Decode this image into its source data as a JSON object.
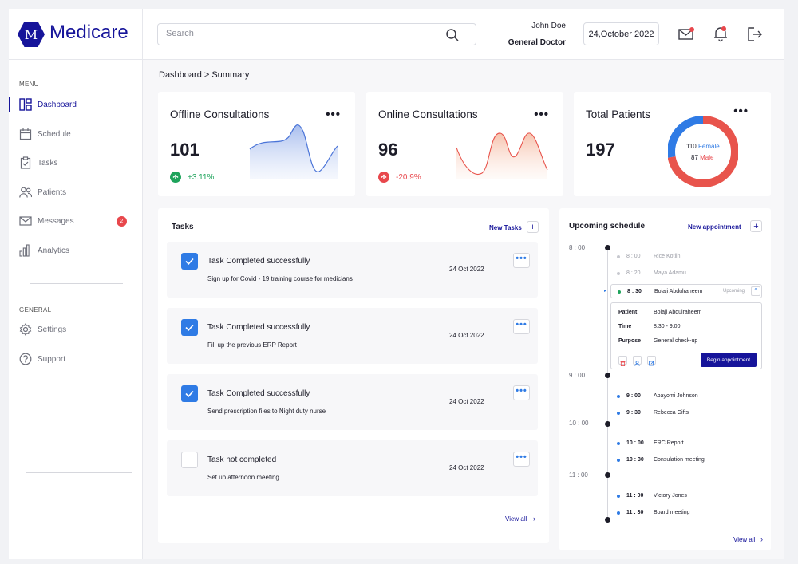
{
  "app": {
    "logo_letter": "M",
    "name": "Medicare"
  },
  "header": {
    "search_placeholder": "Search",
    "user_name": "John Doe",
    "user_role": "General Doctor",
    "date": "24,October 2022"
  },
  "sidebar": {
    "menu_label": "MENU",
    "general_label": "GENERAL",
    "items": [
      {
        "label": "Dashboard",
        "icon": "dashboard-icon"
      },
      {
        "label": "Schedule",
        "icon": "calendar-icon"
      },
      {
        "label": "Tasks",
        "icon": "clipboard-icon"
      },
      {
        "label": "Patients",
        "icon": "users-icon"
      },
      {
        "label": "Messages",
        "icon": "mail-icon",
        "badge": "2"
      },
      {
        "label": "Analytics",
        "icon": "bar-chart-icon"
      }
    ],
    "general_items": [
      {
        "label": "Settings",
        "icon": "gear-icon"
      },
      {
        "label": "Support",
        "icon": "help-icon"
      }
    ]
  },
  "breadcrumb": "Dashboard > Summary",
  "stats": {
    "offline": {
      "title": "Offline Consultations",
      "value": "101",
      "change": "+3.11%"
    },
    "online": {
      "title": "Online Consultations",
      "value": "96",
      "change": "-20.9%"
    },
    "patients": {
      "title": "Total Patients",
      "value": "197",
      "female_count": "110",
      "female_label": "Female",
      "male_count": "87",
      "male_label": "Male"
    }
  },
  "more_glyph": "•••",
  "tasks": {
    "title": "Tasks",
    "new_label": "New Tasks",
    "view_all": "View all",
    "items": [
      {
        "title": "Task Completed successfully",
        "subtitle": "Sign up for Covid - 19 training course for medicians",
        "date": "24 Oct 2022",
        "done": true
      },
      {
        "title": "Task Completed successfully",
        "subtitle": "Fill up the previous ERP Report",
        "date": "24 Oct 2022",
        "done": true
      },
      {
        "title": "Task Completed successfully",
        "subtitle": "Send prescription files to Night duty nurse",
        "date": "24 Oct 2022",
        "done": true
      },
      {
        "title": "Task not completed",
        "subtitle": "Set up afternoon meeting",
        "date": "24 Oct 2022",
        "done": false
      }
    ]
  },
  "schedule": {
    "title": "Upcoming schedule",
    "new_label": "New appointment",
    "view_all": "View all",
    "hours": [
      "8 : 00",
      "9 : 00",
      "10 : 00",
      "11 : 00"
    ],
    "items": [
      {
        "time": "8 : 00",
        "name": "Rice Kotlin"
      },
      {
        "time": "8 : 20",
        "name": "Maya Adamu"
      },
      {
        "time": "8 : 30",
        "name": "Bolaji Abdulraheem",
        "status": "Upcoming"
      },
      {
        "time": "9 : 00",
        "name": "Abayomi Johnson"
      },
      {
        "time": "9 : 30",
        "name": "Rebecca Gifts"
      },
      {
        "time": "10 : 00",
        "name": "ERC Report"
      },
      {
        "time": "10 : 30",
        "name": "Consulation meeting"
      },
      {
        "time": "11 : 00",
        "name": "Victory Jones"
      },
      {
        "time": "11 : 30",
        "name": "Board meeting"
      }
    ],
    "detail": {
      "patient_label": "Patient",
      "patient": "Bolaji Abdulraheem",
      "time_label": "Time",
      "time": "8:30 - 9:00",
      "purpose_label": "Purpose",
      "purpose": "General check-up",
      "begin_label": "Begin appointment"
    }
  },
  "colors": {
    "brand": "#16149a",
    "accent": "#2f7be5",
    "positive": "#1ea35b",
    "negative": "#e8474c"
  }
}
